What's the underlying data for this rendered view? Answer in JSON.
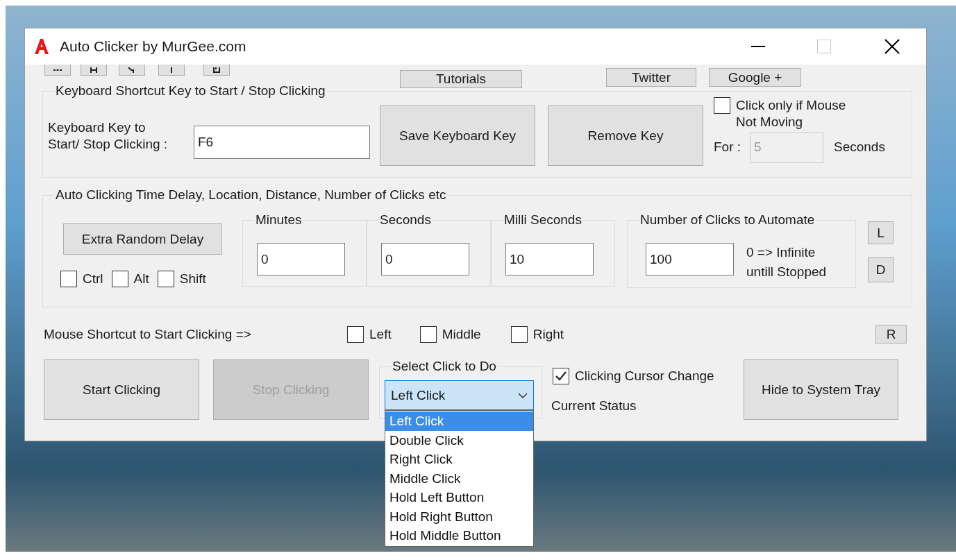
{
  "window": {
    "title": "Auto Clicker by MurGee.com"
  },
  "links": [
    {
      "label": "Tutorials"
    },
    {
      "label": "Twitter"
    },
    {
      "label": "Google +"
    }
  ],
  "keyboard_group": {
    "title": "Keyboard Shortcut Key to Start / Stop Clicking",
    "key_label": "Keyboard Key to\nStart/ Stop Clicking :",
    "key_value": "F6",
    "save_button": "Save Keyboard Key",
    "remove_button": "Remove Key",
    "mouse_not_moving": {
      "label": "Click only if Mouse\nNot Moving",
      "checked": false
    },
    "for_label": "For :",
    "for_value": "5",
    "for_disabled": true,
    "seconds_label": "Seconds"
  },
  "delay_group": {
    "title": "Auto Clicking Time Delay, Location, Distance, Number of Clicks etc",
    "extra_random_delay": "Extra Random Delay",
    "modifiers": [
      {
        "label": "Ctrl",
        "checked": false
      },
      {
        "label": "Alt",
        "checked": false
      },
      {
        "label": "Shift",
        "checked": false
      }
    ],
    "fields": [
      {
        "label": "Minutes",
        "value": "0"
      },
      {
        "label": "Seconds",
        "value": "0"
      },
      {
        "label": "Milli Seconds",
        "value": "10"
      }
    ],
    "clicks": {
      "label": "Number of Clicks to Automate",
      "value": "100",
      "hint": "0 => Infinite\nuntill Stopped"
    },
    "side_buttons": [
      "L",
      "D"
    ]
  },
  "mouse_shortcut": {
    "label": "Mouse Shortcut to Start Clicking =>",
    "options": [
      {
        "label": "Left",
        "checked": false
      },
      {
        "label": "Middle",
        "checked": false
      },
      {
        "label": "Right",
        "checked": false
      }
    ],
    "reset_button": "R"
  },
  "start_button": {
    "label": "Start Clicking",
    "disabled": false
  },
  "stop_button": {
    "label": "Stop Clicking",
    "disabled": true
  },
  "click_type": {
    "title": "Select Click to Do",
    "value": "Left Click",
    "options": [
      {
        "label": "Left Click",
        "selected": true
      },
      {
        "label": "Double Click",
        "selected": false
      },
      {
        "label": "Right Click",
        "selected": false
      },
      {
        "label": "Middle Click",
        "selected": false
      },
      {
        "label": "Hold Left Button",
        "selected": false
      },
      {
        "label": "Hold Right Button",
        "selected": false
      },
      {
        "label": "Hold Middle Button",
        "selected": false
      }
    ]
  },
  "cursor_change": {
    "label": "Clicking Cursor Change",
    "checked": true
  },
  "status_label": "Current Status",
  "hide_button": "Hide to System Tray"
}
